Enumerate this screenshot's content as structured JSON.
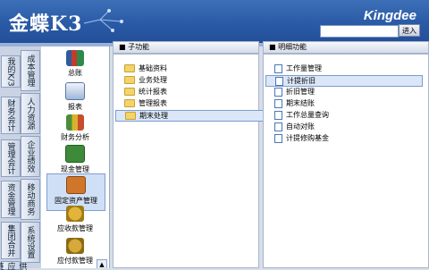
{
  "header": {
    "logo": "金蝶K3",
    "brand": "Kingdee",
    "search_value": "",
    "enter_label": "进入"
  },
  "tabs": [
    {
      "label": "我的K/3",
      "active": false
    },
    {
      "label": "财务会计",
      "active": false
    },
    {
      "label": "管理会计",
      "active": false
    },
    {
      "label": "资金管理",
      "active": false
    },
    {
      "label": "集团合并",
      "active": false
    },
    {
      "label": "供应链",
      "active": false
    },
    {
      "label": "成本管理",
      "active": false
    },
    {
      "label": "人力资源",
      "active": false
    },
    {
      "label": "企业绩效",
      "active": false
    },
    {
      "label": "移动商务",
      "active": false
    },
    {
      "label": "系统设置",
      "active": false
    }
  ],
  "modules": [
    {
      "label": "总账",
      "icon": "ledger-icon"
    },
    {
      "label": "报表",
      "icon": "report-icon"
    },
    {
      "label": "财务分析",
      "icon": "analysis-icon"
    },
    {
      "label": "现金管理",
      "icon": "cash-icon"
    },
    {
      "label": "固定资产管理",
      "icon": "asset-icon",
      "selected": true
    },
    {
      "label": "应收款管理",
      "icon": "receivable-icon"
    },
    {
      "label": "应付款管理",
      "icon": "payable-icon"
    }
  ],
  "mid": {
    "title": "子功能",
    "items": [
      {
        "label": "基础资料"
      },
      {
        "label": "业务处理"
      },
      {
        "label": "统计报表"
      },
      {
        "label": "管理报表"
      },
      {
        "label": "期末处理",
        "selected": true
      }
    ]
  },
  "right": {
    "title": "明细功能",
    "items": [
      {
        "label": "工作量管理"
      },
      {
        "label": "计提折旧",
        "selected": true
      },
      {
        "label": "折旧管理"
      },
      {
        "label": "期末结账"
      },
      {
        "label": "工作总量查询"
      },
      {
        "label": "自动对账"
      },
      {
        "label": "计提修购基金"
      }
    ]
  }
}
